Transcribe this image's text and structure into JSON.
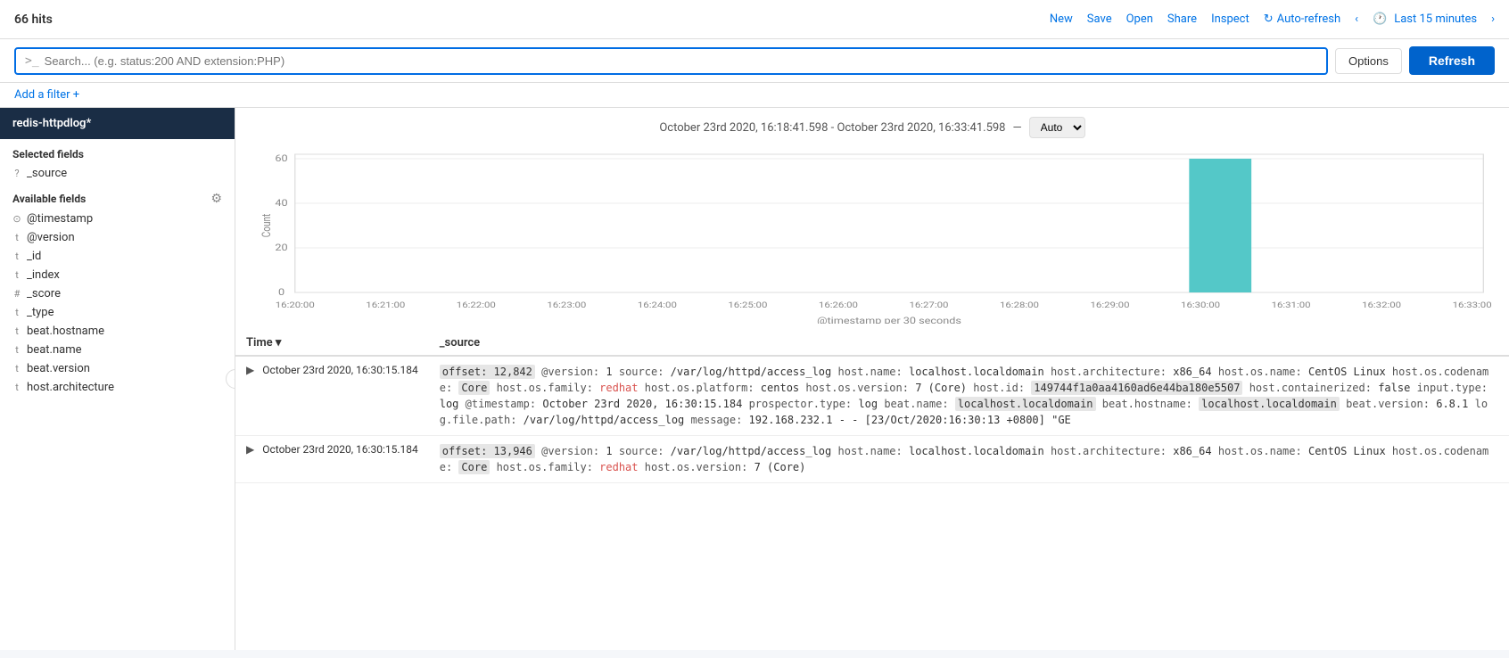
{
  "header": {
    "hits": "66 hits",
    "nav_items": [
      "New",
      "Save",
      "Open",
      "Share",
      "Inspect"
    ],
    "auto_refresh_label": "Auto-refresh",
    "time_label": "Last 15 minutes"
  },
  "search": {
    "prompt": ">_",
    "placeholder": "Search... (e.g. status:200 AND extension:PHP)",
    "options_label": "Options",
    "refresh_label": "Refresh"
  },
  "filter_bar": {
    "add_filter_label": "Add a filter +"
  },
  "sidebar": {
    "index_name": "redis-httpdlog*",
    "selected_fields_title": "Selected fields",
    "selected_fields": [
      {
        "type": "?",
        "name": "_source"
      }
    ],
    "available_fields_title": "Available fields",
    "available_fields": [
      {
        "type": "⊙",
        "name": "@timestamp"
      },
      {
        "type": "t",
        "name": "@version"
      },
      {
        "type": "t",
        "name": "_id"
      },
      {
        "type": "t",
        "name": "_index"
      },
      {
        "type": "#",
        "name": "_score"
      },
      {
        "type": "t",
        "name": "_type"
      },
      {
        "type": "t",
        "name": "beat.hostname"
      },
      {
        "type": "t",
        "name": "beat.name"
      },
      {
        "type": "t",
        "name": "beat.version"
      },
      {
        "type": "t",
        "name": "host.architecture"
      }
    ]
  },
  "chart": {
    "time_range": "October 23rd 2020, 16:18:41.598 - October 23rd 2020, 16:33:41.598",
    "interval_label": "Auto",
    "x_label": "@timestamp per 30 seconds",
    "x_ticks": [
      "16:20:00",
      "16:21:00",
      "16:22:00",
      "16:23:00",
      "16:24:00",
      "16:25:00",
      "16:26:00",
      "16:27:00",
      "16:28:00",
      "16:29:00",
      "16:30:00",
      "16:31:00",
      "16:32:00",
      "16:33:00"
    ],
    "y_ticks": [
      "0",
      "20",
      "40",
      "60"
    ],
    "bar_position": 10,
    "bar_height_pct": 95,
    "bar_color": "#54c8c8"
  },
  "results": {
    "columns": [
      "Time",
      "_source"
    ],
    "rows": [
      {
        "time": "October 23rd 2020, 16:30:15.184",
        "source": "offset: 12,842  @version: 1  source: /var/log/httpd/access_log  host.name: localhost.localdomain  host.architecture: x86_64  host.os.name: CentOS Linux  host.os.codename: Core  host.os.family: redhat  host.os.platform: centos  host.os.version: 7 (Core)  host.id: 149744f1a0aa4160ad6e44ba180e5507  host.containerized: false  input.type: log  @timestamp: October 23rd 2020, 16:30:15.184  prospector.type: log  beat.name: localhost.localdomain  beat.hostname: localhost.localdomain  beat.version: 6.8.1  log.file.path: /var/log/httpd/access_log  message: 192.168.232.1 - - [23/Oct/2020:16:30:13 +0800] \"GE"
      },
      {
        "time": "October 23rd 2020, 16:30:15.184",
        "source": "offset: 13,946  @version: 1  source: /var/log/httpd/access_log  host.name: localhost.localdomain  host.architecture: x86_64  host.os.name: CentOS Linux  host.os.codename: Core  host.os.family: redhat  host.os.version: 7 (Core)"
      }
    ]
  }
}
